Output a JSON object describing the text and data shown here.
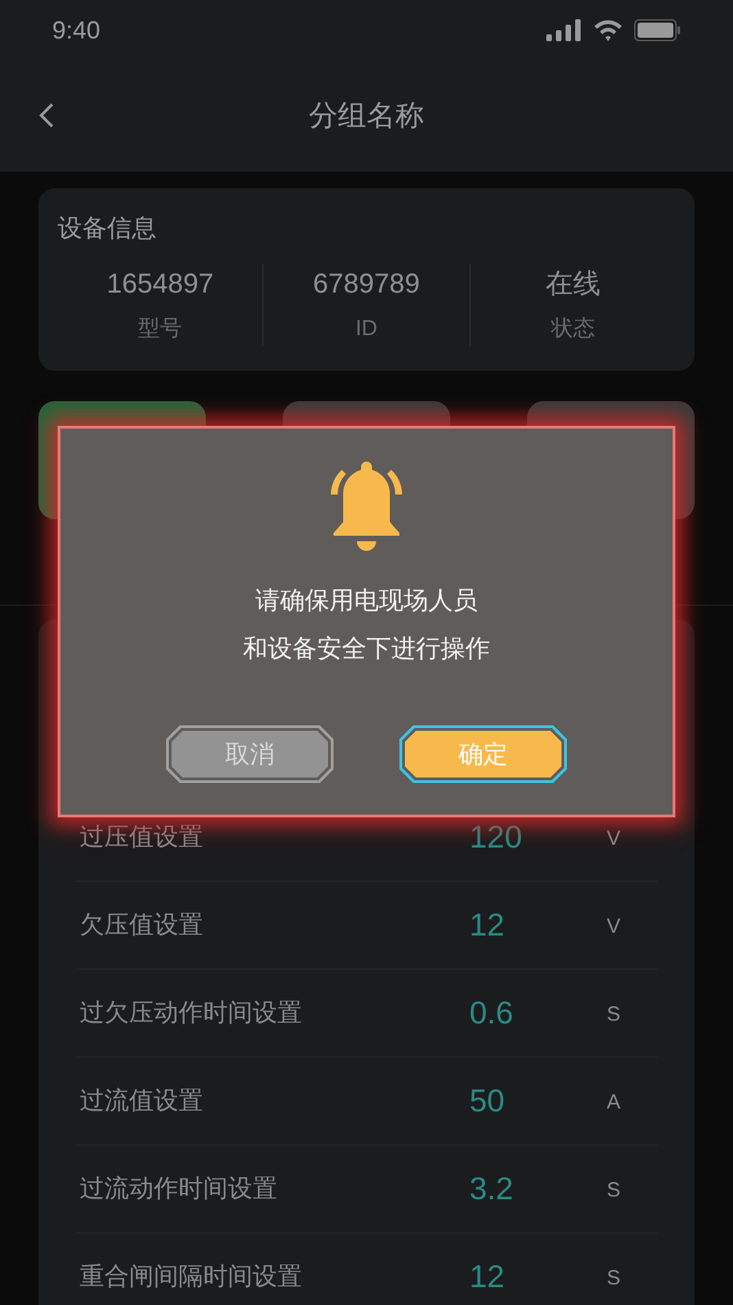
{
  "status_bar": {
    "time": "9:40"
  },
  "nav": {
    "title": "分组名称"
  },
  "device_info": {
    "title": "设备信息",
    "fields": [
      {
        "value": "1654897",
        "label": "型号"
      },
      {
        "value": "6789789",
        "label": "ID"
      },
      {
        "value": "在线",
        "label": "状态"
      }
    ]
  },
  "action_tiles": [
    {
      "color": "#24653a"
    },
    {
      "color": "#3a3a3a"
    },
    {
      "color": "#3a3a3a"
    }
  ],
  "settings": [
    {
      "label": "过压值设置",
      "value": "120",
      "unit": "V"
    },
    {
      "label": "欠压值设置",
      "value": "12",
      "unit": "V"
    },
    {
      "label": "过欠压动作时间设置",
      "value": "0.6",
      "unit": "S"
    },
    {
      "label": "过流值设置",
      "value": "50",
      "unit": "A"
    },
    {
      "label": "过流动作时间设置",
      "value": "3.2",
      "unit": "S"
    },
    {
      "label": "重合闸间隔时间设置",
      "value": "12",
      "unit": "S"
    }
  ],
  "dialog": {
    "message": [
      "请确保用电现场人员",
      "和设备安全下进行操作"
    ],
    "buttons": [
      {
        "label": "取消",
        "kind": "cancel"
      },
      {
        "label": "确定",
        "kind": "confirm"
      }
    ]
  }
}
